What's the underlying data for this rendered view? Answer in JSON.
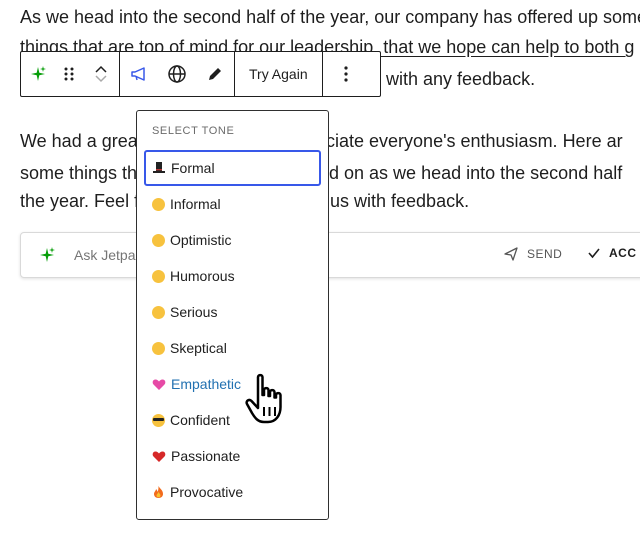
{
  "paragraph1": {
    "line1": "As we head into the second half of the year, our company has offered up some",
    "line2": "things that are top of mind for our leadership, that we hope can help to both g",
    "line3_visible": "s with any feedback."
  },
  "paragraph2": {
    "line1_left": "We had a great",
    "line1_right": "reciate everyone's enthusiasm. Here ar",
    "line2_left": "some things th",
    "line2_right": "sed on as we head into the second half",
    "line3_left": "the year. Feel f",
    "line3_right": "f us with feedback."
  },
  "toolbar": {
    "try_again_label": "Try Again"
  },
  "ask_bar": {
    "placeholder": "Ask Jetpa",
    "send_label": "SEND",
    "accept_label": "ACC"
  },
  "tone_menu": {
    "header": "SELECT TONE",
    "selected": "Formal",
    "hovered": "Empathetic",
    "options": [
      {
        "label": "Formal",
        "icon": "top-hat-icon"
      },
      {
        "label": "Informal",
        "icon": "smiling-face-icon"
      },
      {
        "label": "Optimistic",
        "icon": "grinning-face-icon"
      },
      {
        "label": "Humorous",
        "icon": "laughing-face-icon"
      },
      {
        "label": "Serious",
        "icon": "neutral-face-icon"
      },
      {
        "label": "Skeptical",
        "icon": "raised-eyebrow-face-icon"
      },
      {
        "label": "Empathetic",
        "icon": "heart-icon"
      },
      {
        "label": "Confident",
        "icon": "sunglasses-face-icon"
      },
      {
        "label": "Passionate",
        "icon": "red-heart-icon"
      },
      {
        "label": "Provocative",
        "icon": "fire-icon"
      }
    ]
  },
  "colors": {
    "accent": "#3858e9",
    "hover_text": "#2271b1",
    "sparkle": "#069e08"
  }
}
